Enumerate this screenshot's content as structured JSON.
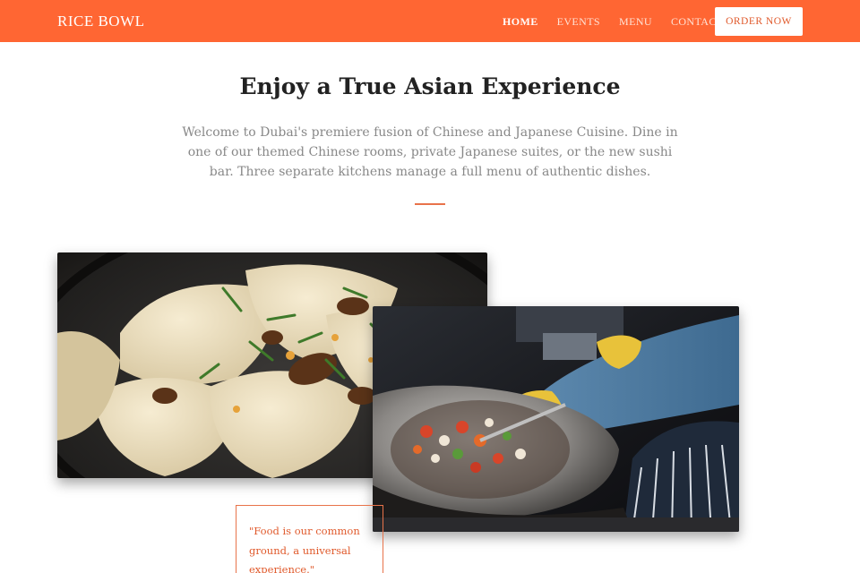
{
  "brand": {
    "name": "RICE BOWL"
  },
  "nav": {
    "links": [
      "HOME",
      "EVENTS",
      "MENU",
      "CONTACT"
    ],
    "active": "HOME",
    "cta_label": "ORDER NOW"
  },
  "hero": {
    "title": "Enjoy a True Asian Experience",
    "paragraph": "Welcome to Dubai's premiere fusion of Chinese and Japanese Cuisine. Dine in one of our themed Chinese rooms, private Japanese suites, or the new sushi bar. Three separate kitchens manage a full menu of authentic dishes."
  },
  "quote": {
    "text": "\"Food is our common ground, a universal experience.\""
  },
  "colors": {
    "accent": "#ff6633",
    "accent_text": "#e05a2c",
    "muted_text": "#888888"
  }
}
